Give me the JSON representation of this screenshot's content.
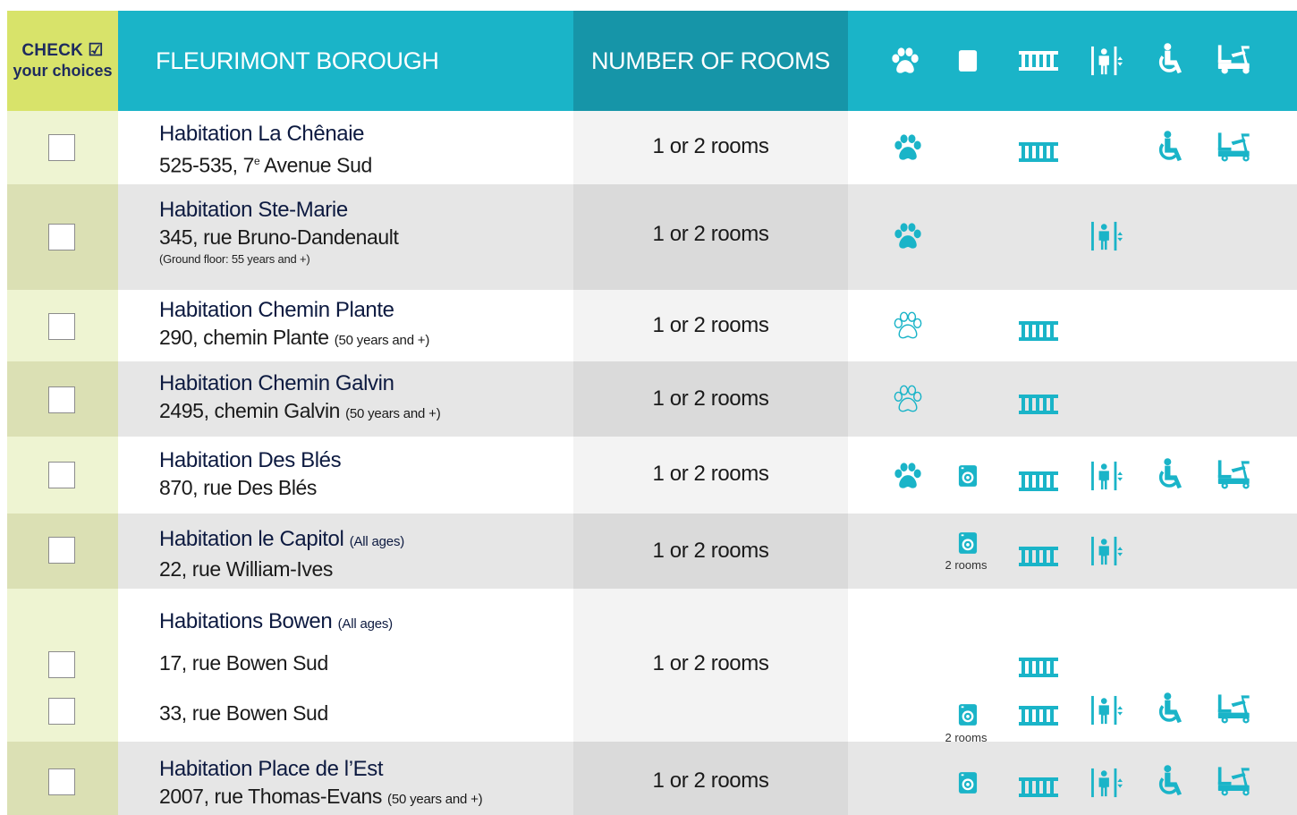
{
  "header": {
    "check_line1": "CHECK ☑",
    "check_line2": "your choices",
    "borough": "FLEURIMONT BOROUGH",
    "rooms": "NUMBER OF ROOMS",
    "icons": [
      "paw-icon",
      "washer-icon",
      "balcony-icon",
      "elevator-icon",
      "wheelchair-icon",
      "mobility-scooter-icon"
    ]
  },
  "colors": {
    "header_teal": "#1ab4c8",
    "header_teal_dark": "#1695a8",
    "check_header": "#d8e36a",
    "icon_teal": "#1ab4c8"
  },
  "rows": [
    {
      "name": "Habitation La Chênaie",
      "address_pre": "525-535, 7",
      "address_sup": "e",
      "address_post": " Avenue Sud",
      "rooms": "1 or 2 rooms"
    },
    {
      "name": "Habitation Ste-Marie",
      "address": "345, rue Bruno-Dandenault",
      "note": "(Ground floor: 55 years and +)",
      "rooms": "1 or 2 rooms"
    },
    {
      "name": "Habitation Chemin Plante",
      "address": "290, chemin Plante",
      "address_small": "(50 years and +)",
      "rooms": "1 or 2 rooms"
    },
    {
      "name": "Habitation Chemin Galvin",
      "address": "2495, chemin Galvin",
      "address_small": "(50 years and +)",
      "rooms": "1 or 2 rooms"
    },
    {
      "name": "Habitation Des Blés",
      "address": "870, rue Des Blés",
      "rooms": "1 or 2 rooms"
    },
    {
      "name": "Habitation le Capitol",
      "name_small": "(All ages)",
      "address": "22, rue William-Ives",
      "rooms": "1 or 2 rooms",
      "washer_note": "2 rooms"
    },
    {
      "name": "Habitations Bowen",
      "name_small": "(All ages)",
      "address_1": "17, rue Bowen Sud",
      "address_2": "33, rue Bowen Sud",
      "rooms": "1 or 2 rooms",
      "washer_note": "2 rooms"
    },
    {
      "name": "Habitation Place de l’Est",
      "address": "2007, rue Thomas-Evans",
      "address_small": "(50 years and +)",
      "rooms": "1 or 2 rooms"
    }
  ]
}
